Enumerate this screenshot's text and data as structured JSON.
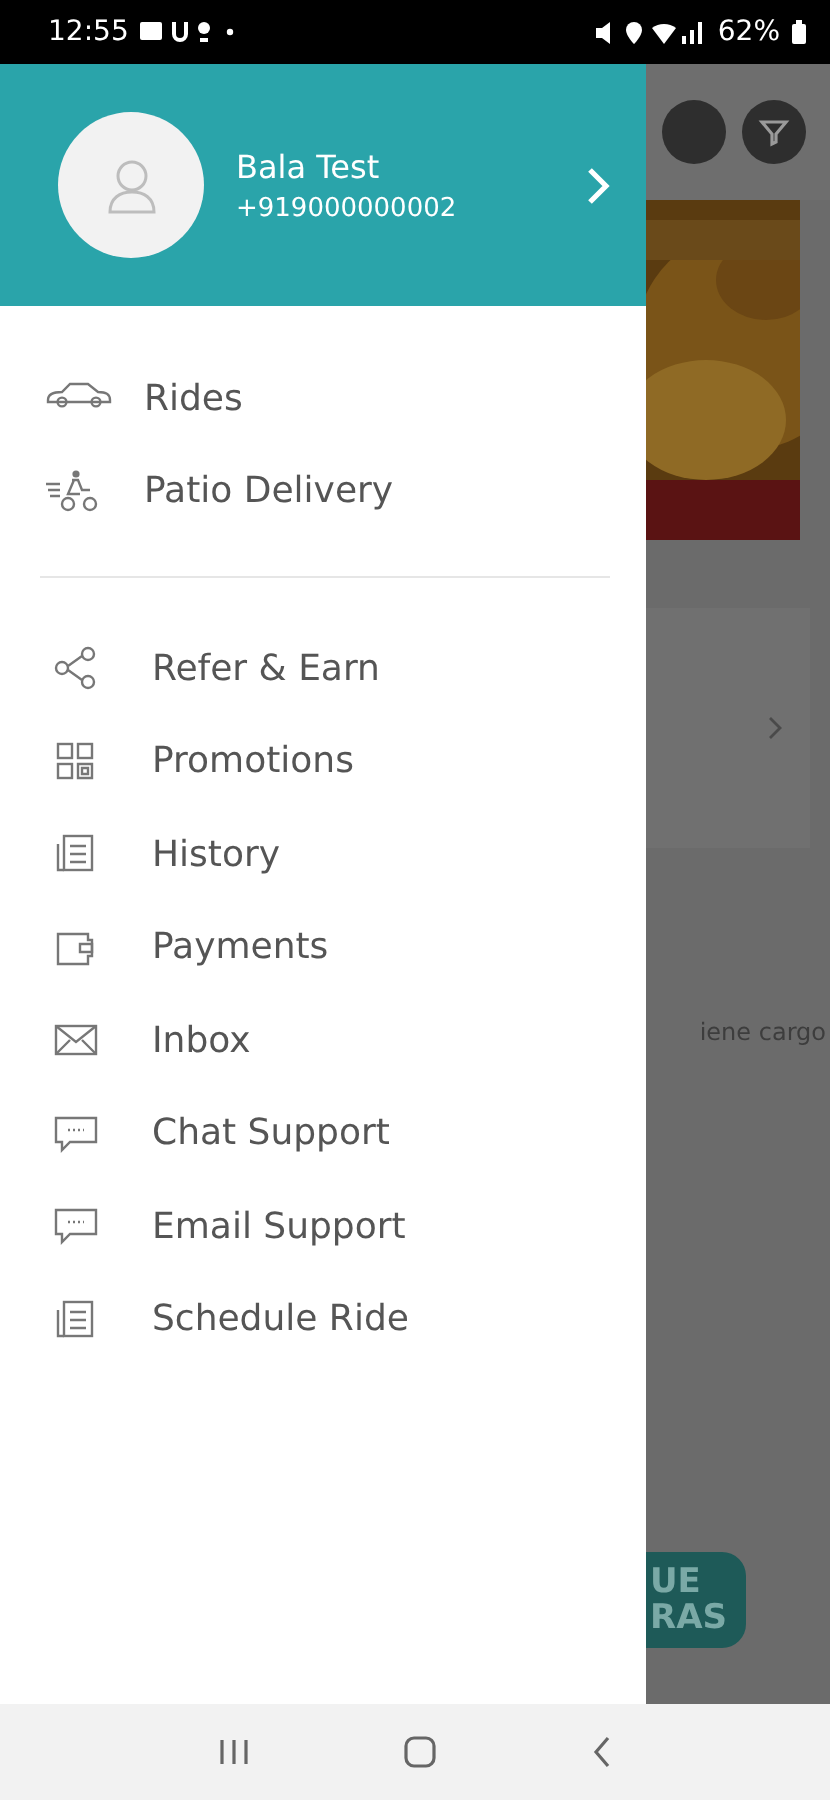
{
  "status_bar": {
    "time": "12:55",
    "battery": "62%"
  },
  "drawer": {
    "profile": {
      "name": "Bala Test",
      "phone": "+919000000002"
    },
    "sections": [
      {
        "items": [
          {
            "kind": "car",
            "label": "Rides"
          },
          {
            "kind": "delivery",
            "label": "Patio Delivery"
          }
        ]
      },
      {
        "items": [
          {
            "kind": "share",
            "label": "Refer & Earn"
          },
          {
            "kind": "qr",
            "label": "Promotions"
          },
          {
            "kind": "list",
            "label": "History"
          },
          {
            "kind": "wallet",
            "label": "Payments"
          },
          {
            "kind": "mail",
            "label": "Inbox"
          },
          {
            "kind": "chat",
            "label": "Chat Support"
          },
          {
            "kind": "chat",
            "label": "Email Support"
          },
          {
            "kind": "list",
            "label": "Schedule Ride"
          }
        ]
      }
    ]
  },
  "background": {
    "note": "iene cargo",
    "button_lines": [
      "UE",
      "RAS"
    ]
  }
}
